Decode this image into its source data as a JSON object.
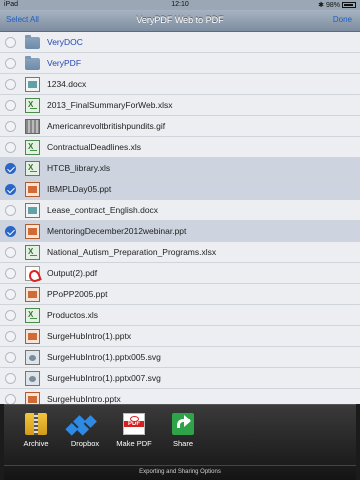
{
  "status_bar": {
    "carrier": "iPad",
    "time": "12:10",
    "battery_percent": "98%"
  },
  "nav": {
    "title": "VeryPDF Web to PDF",
    "left_button": "Select All",
    "right_button": "Done"
  },
  "files": [
    {
      "name": "VeryDOC",
      "icon": "folder-icon",
      "selected": false
    },
    {
      "name": "VeryPDF",
      "icon": "folder-icon",
      "selected": false
    },
    {
      "name": "1234.docx",
      "icon": "doc-icon",
      "selected": false
    },
    {
      "name": "2013_FinalSummaryForWeb.xlsx",
      "icon": "xls-icon",
      "selected": false
    },
    {
      "name": "Americanrevoltbritishpundits.gif",
      "icon": "image-icon",
      "selected": false
    },
    {
      "name": "ContractualDeadlines.xls",
      "icon": "xls-icon",
      "selected": false
    },
    {
      "name": "HTCB_library.xls",
      "icon": "xls-icon",
      "selected": true
    },
    {
      "name": "IBMPLDay05.ppt",
      "icon": "ppt-icon",
      "selected": true
    },
    {
      "name": "Lease_contract_English.docx",
      "icon": "doc-icon",
      "selected": false
    },
    {
      "name": "MentoringDecember2012webinar.ppt",
      "icon": "ppt-icon",
      "selected": true
    },
    {
      "name": "National_Autism_Preparation_Programs.xlsx",
      "icon": "xls-icon",
      "selected": false
    },
    {
      "name": "Output(2).pdf",
      "icon": "pdf-icon",
      "selected": false
    },
    {
      "name": "PPoPP2005.ppt",
      "icon": "ppt-icon",
      "selected": false
    },
    {
      "name": "Productos.xls",
      "icon": "xls-icon",
      "selected": false
    },
    {
      "name": "SurgeHubIntro(1).pptx",
      "icon": "ppt-icon",
      "selected": false
    },
    {
      "name": "SurgeHubIntro(1).pptx005.svg",
      "icon": "svg-icon",
      "selected": false
    },
    {
      "name": "SurgeHubIntro(1).pptx007.svg",
      "icon": "svg-icon",
      "selected": false
    },
    {
      "name": "SurgeHubIntro.pptx",
      "icon": "ppt-icon",
      "selected": false
    }
  ],
  "actions": [
    {
      "label": "Archive",
      "icon": "archive-icon"
    },
    {
      "label": "Dropbox",
      "icon": "dropbox-icon"
    },
    {
      "label": "Make PDF",
      "icon": "pdf-icon"
    },
    {
      "label": "Share",
      "icon": "share-icon"
    }
  ],
  "sheet_caption": "Exporting and Sharing Options",
  "colors": {
    "accent": "#2a66c8",
    "selected_row": "#cdd4df",
    "folder_text": "#2346b5"
  }
}
